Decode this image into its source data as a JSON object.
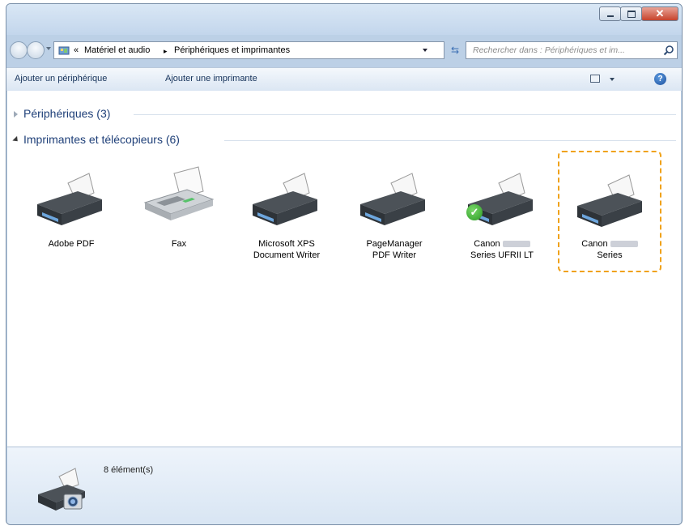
{
  "window": {
    "close_label": "✕"
  },
  "address": {
    "crumb_prefix": "«",
    "crumb1": "Matériel et audio",
    "separator": "▸",
    "crumb2": "Périphériques et imprimantes"
  },
  "search": {
    "placeholder": "Rechercher dans : Périphériques et im..."
  },
  "toolbar": {
    "add_device": "Ajouter un périphérique",
    "add_printer": "Ajouter une imprimante",
    "help": "?"
  },
  "groups": {
    "devices": "Périphériques (3)",
    "printers": "Imprimantes et télécopieurs (6)"
  },
  "items": [
    {
      "line1": "Adobe PDF",
      "line2": ""
    },
    {
      "line1": "Fax",
      "line2": ""
    },
    {
      "line1": "Microsoft XPS",
      "line2": "Document Writer"
    },
    {
      "line1": "PageManager",
      "line2": "PDF Writer"
    },
    {
      "line1": "Canon",
      "line2": "Series UFRII LT",
      "default": true
    },
    {
      "line1": "Canon",
      "line2": "Series",
      "selected": true
    }
  ],
  "status": {
    "count": "8 élément(s)"
  },
  "colors": {
    "selection": "#f0a21a",
    "group_title": "#1e3f78"
  }
}
